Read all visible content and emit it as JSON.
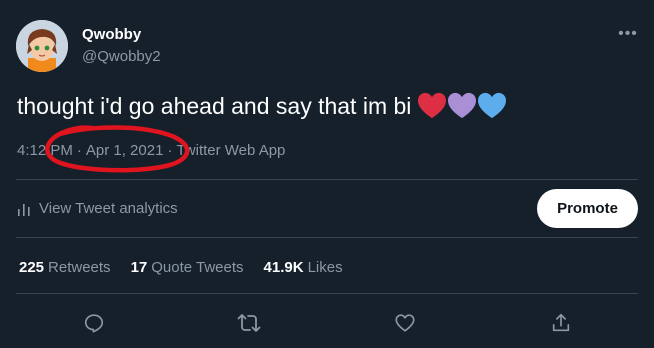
{
  "user": {
    "display_name": "Qwobby",
    "handle": "@Qwobby2"
  },
  "tweet": {
    "text": "thought i'd go ahead and say that im bi",
    "emojis": [
      "red-heart",
      "purple-heart",
      "blue-heart"
    ],
    "time": "4:12 PM",
    "date": "Apr 1, 2021",
    "source": "Twitter Web App",
    "separator": "·"
  },
  "analytics": {
    "label": "View Tweet analytics",
    "icon": "bar-chart-icon"
  },
  "promote": {
    "label": "Promote"
  },
  "stats": {
    "retweets": {
      "count": "225",
      "label": "Retweets"
    },
    "quote_tweets": {
      "count": "17",
      "label": "Quote Tweets"
    },
    "likes": {
      "count": "41.9K",
      "label": "Likes"
    }
  },
  "actions": [
    "reply-icon",
    "retweet-icon",
    "like-icon",
    "share-icon"
  ],
  "colors": {
    "background": "#15202b",
    "secondary_text": "#8b98a5",
    "divider": "#38444d",
    "annotation": "#e0141e",
    "red_heart": "#dd2e44",
    "purple_heart": "#aa8ed6",
    "blue_heart": "#5dadec"
  }
}
